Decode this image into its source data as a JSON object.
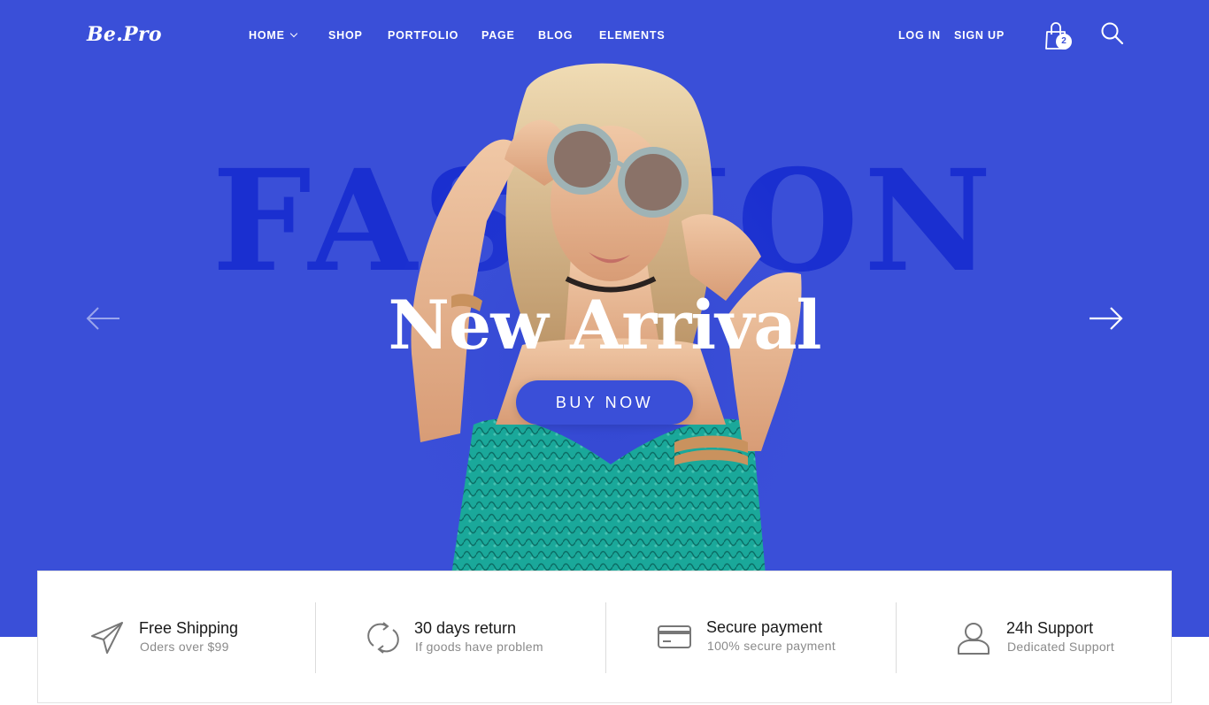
{
  "header": {
    "logo": "Be.Pro",
    "nav": [
      {
        "label": "HOME"
      },
      {
        "label": "SHOP"
      },
      {
        "label": "PORTFOLIO"
      },
      {
        "label": "PAGE"
      },
      {
        "label": "BLOG"
      },
      {
        "label": "ELEMENTS"
      }
    ],
    "login_label": "LOG IN",
    "signup_label": "SIGN UP",
    "cart_count": "2",
    "icons": [
      "chevron-down-icon",
      "shopping-bag-icon",
      "search-icon"
    ]
  },
  "hero": {
    "background_word": "FASHION",
    "headline": "New Arrival",
    "cta_label": "BUY NOW",
    "icons": [
      "arrow-left-icon",
      "arrow-right-icon"
    ]
  },
  "features": [
    {
      "icon": "paper-plane-icon",
      "title": "Free Shipping",
      "subtitle": "Oders over $99"
    },
    {
      "icon": "refresh-icon",
      "title": "30 days return",
      "subtitle": "If goods have problem"
    },
    {
      "icon": "credit-card-icon",
      "title": "Secure payment",
      "subtitle": "100% secure payment"
    },
    {
      "icon": "user-icon",
      "title": "24h Support",
      "subtitle": "Dedicated Support"
    }
  ],
  "colors": {
    "brand_blue": "#3a4fd8",
    "text_dark": "#1a1a1a",
    "text_muted": "#8a8a8a",
    "swimsuit_teal": "#1aa89a"
  }
}
